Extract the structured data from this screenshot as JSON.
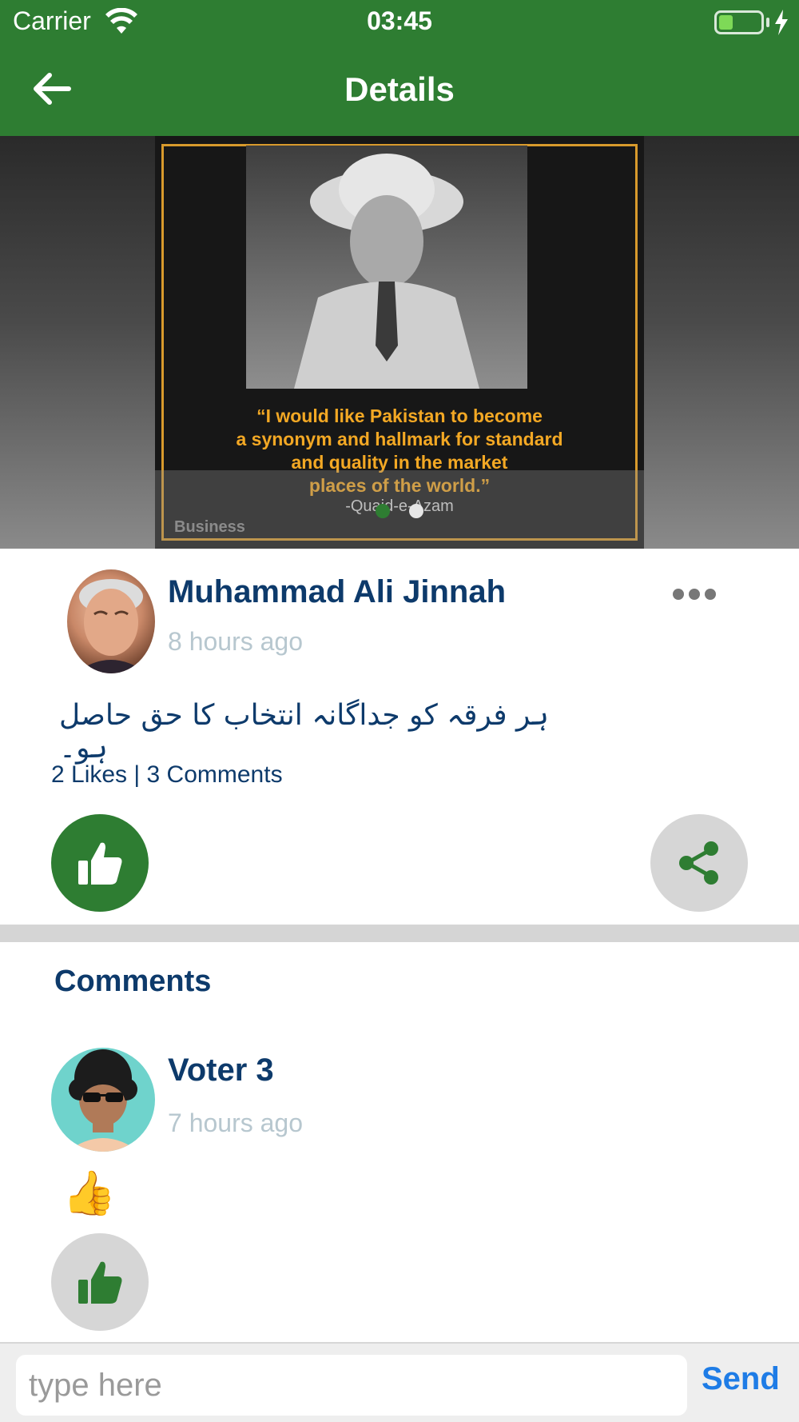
{
  "status_bar": {
    "carrier": "Carrier",
    "time": "03:45"
  },
  "nav": {
    "title": "Details"
  },
  "hero": {
    "quote_line1": "“I would like Pakistan to become",
    "quote_line2": "a synonym and hallmark for standard",
    "quote_line3": "and quality in the market",
    "quote_line4": "places of the world.”",
    "author": "-Quaid-e-Azam",
    "brand": "Business",
    "carousel_active_index": 0,
    "carousel_count": 2
  },
  "post": {
    "author_name": "Muhammad Ali Jinnah",
    "time_ago": "8 hours ago",
    "text": "ہر فرقہ کو جداگانہ انتخاب کا حق حاصل ہو۔",
    "stats": "2 Likes | 3 Comments"
  },
  "comments": {
    "title": "Comments",
    "items": [
      {
        "name": "Voter 3",
        "time_ago": "7 hours ago",
        "content": "👍"
      }
    ]
  },
  "composer": {
    "placeholder": "type here",
    "send_label": "Send"
  },
  "colors": {
    "brand_green": "#2e7d32",
    "title_blue": "#0d3a6b",
    "muted": "#b7c7cf",
    "send_blue": "#1e7ce6",
    "quote_gold": "#f3a824"
  },
  "icons": {
    "back": "arrow-left-icon",
    "more": "more-horizontal-icon",
    "like": "thumbs-up-icon",
    "share": "share-icon",
    "wifi": "wifi-icon",
    "battery": "battery-icon"
  }
}
